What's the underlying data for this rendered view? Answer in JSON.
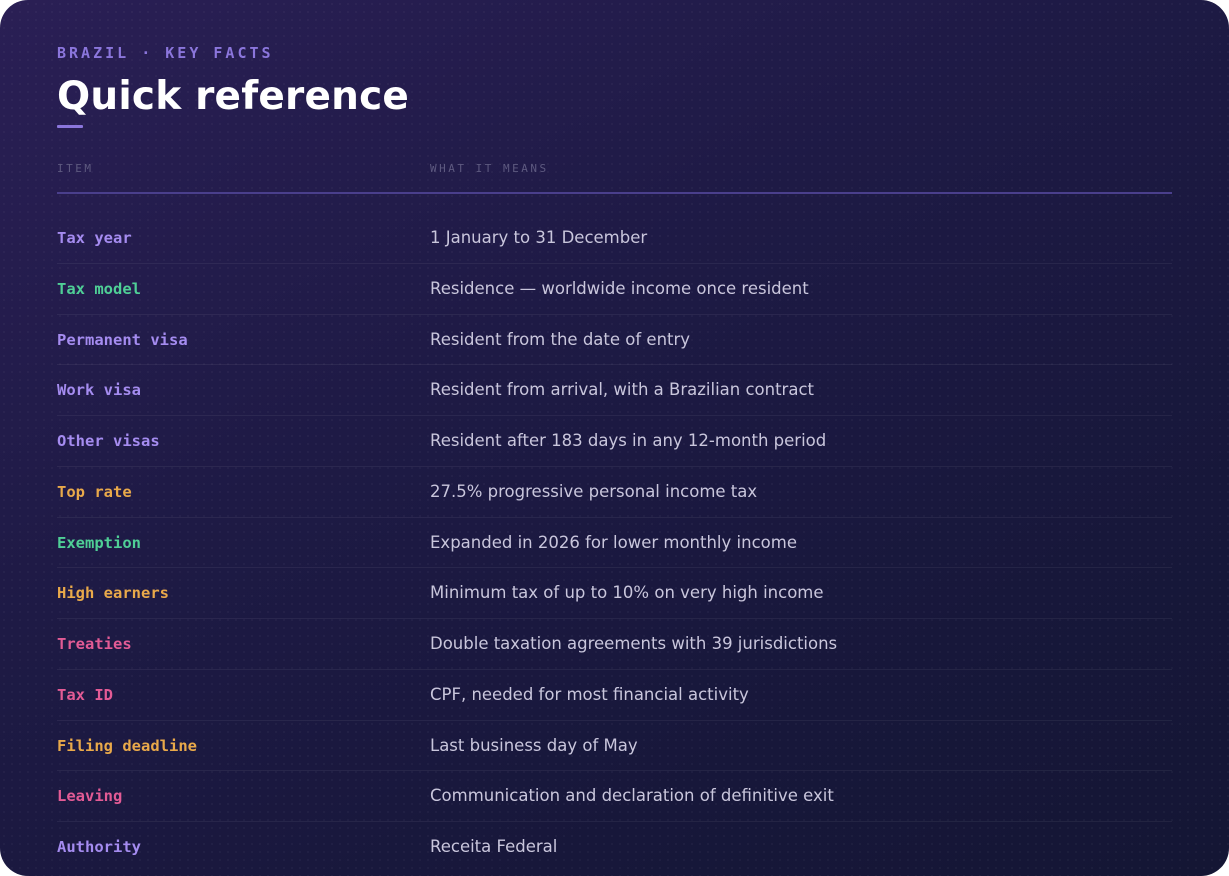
{
  "eyebrow": "BRAZIL · KEY FACTS",
  "title": "Quick reference",
  "columns": {
    "item": "ITEM",
    "meaning": "WHAT IT MEANS"
  },
  "colors": {
    "accent": "#8b76dc",
    "purple": "#a58cf0",
    "green": "#4fcf96",
    "amber": "#e9a94a",
    "pink": "#e35b95"
  },
  "rows": [
    {
      "item": "Tax year",
      "meaning": "1 January to 31 December",
      "color": "purple"
    },
    {
      "item": "Tax model",
      "meaning": "Residence — worldwide income once resident",
      "color": "green"
    },
    {
      "item": "Permanent visa",
      "meaning": "Resident from the date of entry",
      "color": "purple"
    },
    {
      "item": "Work visa",
      "meaning": "Resident from arrival, with a Brazilian contract",
      "color": "purple"
    },
    {
      "item": "Other visas",
      "meaning": "Resident after 183 days in any 12-month period",
      "color": "purple"
    },
    {
      "item": "Top rate",
      "meaning": "27.5% progressive personal income tax",
      "color": "amber"
    },
    {
      "item": "Exemption",
      "meaning": "Expanded in 2026 for lower monthly income",
      "color": "green"
    },
    {
      "item": "High earners",
      "meaning": "Minimum tax of up to 10% on very high income",
      "color": "amber"
    },
    {
      "item": "Treaties",
      "meaning": "Double taxation agreements with 39 jurisdictions",
      "color": "pink"
    },
    {
      "item": "Tax ID",
      "meaning": "CPF, needed for most financial activity",
      "color": "pink"
    },
    {
      "item": "Filing deadline",
      "meaning": "Last business day of May",
      "color": "amber"
    },
    {
      "item": "Leaving",
      "meaning": "Communication and declaration of definitive exit",
      "color": "pink"
    },
    {
      "item": "Authority",
      "meaning": "Receita Federal",
      "color": "purple"
    }
  ]
}
